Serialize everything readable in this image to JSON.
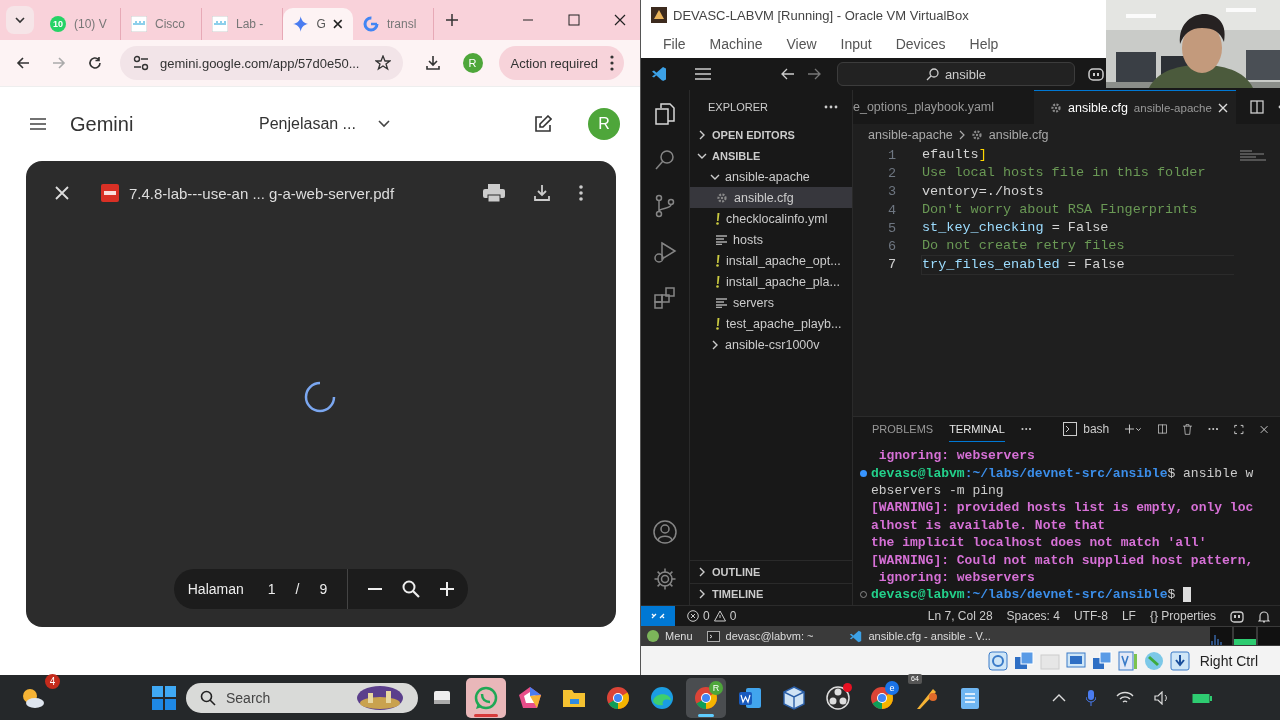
{
  "browser": {
    "tabs": [
      {
        "label": "(10) V",
        "kind": "whatsapp",
        "badge": "10",
        "selected": false
      },
      {
        "label": "Cisco",
        "kind": "cisco",
        "selected": false
      },
      {
        "label": "Lab -",
        "kind": "cisco",
        "selected": false
      },
      {
        "label": "G",
        "kind": "gemini",
        "selected": true
      },
      {
        "label": "transl",
        "kind": "google",
        "selected": false
      }
    ],
    "address": "gemini.google.com/app/57d0e50...",
    "profile_initial": "R",
    "action_button": "Action required"
  },
  "gemini": {
    "title": "Gemini",
    "conversation": "Penjelasan ...",
    "avatar_initial": "R",
    "pdf_viewer": {
      "file_name": "7.4.8-lab---use-an ... g-a-web-server.pdf",
      "loading": true,
      "page_label": "Halaman",
      "page": "1",
      "separator": "/",
      "page_count": "9"
    }
  },
  "vm_window": {
    "title": "DEVASC-LABVM [Running] - Oracle VM VirtualBox",
    "menu": [
      "File",
      "Machine",
      "View",
      "Input",
      "Devices",
      "Help"
    ],
    "host_key": "Right Ctrl"
  },
  "vscode": {
    "search": "ansible",
    "activity_bar": [
      {
        "kind": "explorer",
        "selected": true
      },
      {
        "kind": "search",
        "selected": false
      },
      {
        "kind": "source-control",
        "selected": false
      },
      {
        "kind": "run",
        "selected": false
      },
      {
        "kind": "extensions",
        "selected": false
      }
    ],
    "explorer": {
      "title": "EXPLORER",
      "sections": [
        {
          "label": "OPEN EDITORS",
          "expanded": false,
          "selected": false
        },
        {
          "label": "ANSIBLE",
          "expanded": true,
          "selected": false,
          "children": [
            {
              "label": "ansible-apache",
              "kind": "folder",
              "expanded": true,
              "selected": false,
              "children": [
                {
                  "label": "ansible.cfg",
                  "kind": "gear",
                  "selected": true
                },
                {
                  "label": "checklocalinfo.yml",
                  "kind": "yaml",
                  "selected": false
                },
                {
                  "label": "hosts",
                  "kind": "lines",
                  "selected": false
                },
                {
                  "label": "install_apache_opt...",
                  "kind": "yaml",
                  "selected": false
                },
                {
                  "label": "install_apache_pla...",
                  "kind": "yaml",
                  "selected": false
                },
                {
                  "label": "servers",
                  "kind": "lines",
                  "selected": false
                },
                {
                  "label": "test_apache_playb...",
                  "kind": "yaml",
                  "selected": false
                }
              ]
            },
            {
              "label": "ansible-csr1000v",
              "kind": "folder",
              "expanded": false,
              "selected": false
            }
          ]
        }
      ],
      "bottom_sections": [
        {
          "label": "OUTLINE",
          "expanded": false
        },
        {
          "label": "TIMELINE",
          "expanded": false
        }
      ]
    },
    "editor_tabs": [
      {
        "label": "e_options_playbook.yaml",
        "selected": false
      },
      {
        "label": "ansible.cfg",
        "description": "ansible-apache",
        "selected": true
      }
    ],
    "breadcrumb": [
      "ansible-apache",
      "ansible.cfg"
    ],
    "code_lines": [
      {
        "number": "1",
        "current": false,
        "tokens": [
          {
            "text": "efaults",
            "kind": "plain"
          },
          {
            "text": "]",
            "kind": "bracket"
          }
        ]
      },
      {
        "number": "2",
        "current": false,
        "tokens": [
          {
            "text": "Use local hosts file in this folder",
            "kind": "comment"
          }
        ]
      },
      {
        "number": "3",
        "current": false,
        "tokens": [
          {
            "text": "ventory=./hosts",
            "kind": "plain"
          }
        ]
      },
      {
        "number": "4",
        "current": false,
        "tokens": [
          {
            "text": "Don't worry about RSA Fingerprints",
            "kind": "comment"
          }
        ]
      },
      {
        "number": "5",
        "current": false,
        "tokens": [
          {
            "text": "st_key_checking",
            "kind": "key"
          },
          {
            "text": " = False",
            "kind": "plain"
          }
        ]
      },
      {
        "number": "6",
        "current": false,
        "tokens": [
          {
            "text": "Do not create retry files",
            "kind": "comment"
          }
        ]
      },
      {
        "number": "7",
        "current": true,
        "tokens": [
          {
            "text": "try_files_enabled",
            "kind": "key"
          },
          {
            "text": " = False",
            "kind": "plain"
          }
        ]
      }
    ],
    "panel": {
      "tabs": [
        {
          "label": "PROBLEMS",
          "selected": false
        },
        {
          "label": "TERMINAL",
          "selected": true
        }
      ],
      "shell": "bash",
      "terminal_lines": [
        {
          "tokens": [
            {
              "text": " ignoring: webservers",
              "kind": "warning"
            }
          ]
        },
        {
          "kind": "prompt",
          "completed": true,
          "tokens": [
            {
              "text": "devasc@labvm",
              "kind": "user"
            },
            {
              "text": ":~/labs/devnet-src/ansible",
              "kind": "path"
            },
            {
              "text": "$ ansible w",
              "kind": "plain"
            }
          ]
        },
        {
          "tokens": [
            {
              "text": "ebservers -m ping",
              "kind": "plain"
            }
          ]
        },
        {
          "tokens": [
            {
              "text": "[WARNING]: provided hosts list is empty, only loc",
              "kind": "warning"
            }
          ]
        },
        {
          "tokens": [
            {
              "text": "alhost is available. Note that",
              "kind": "warning"
            }
          ]
        },
        {
          "tokens": [
            {
              "text": "the implicit localhost does not match 'all'",
              "kind": "warning"
            }
          ]
        },
        {
          "tokens": [
            {
              "text": "[WARNING]: Could not match supplied host pattern,",
              "kind": "warning"
            }
          ]
        },
        {
          "tokens": [
            {
              "text": " ignoring: webservers",
              "kind": "warning"
            }
          ]
        },
        {
          "kind": "prompt",
          "completed": false,
          "cursor": true,
          "tokens": [
            {
              "text": "devasc@labvm",
              "kind": "user"
            },
            {
              "text": ":~/labs/devnet-src/ansible",
              "kind": "path"
            },
            {
              "text": "$",
              "kind": "plain"
            }
          ]
        }
      ]
    },
    "status_bar": {
      "errors": "0",
      "warnings": "0",
      "items": [
        "Ln 7, Col 28",
        "Spaces: 4",
        "UTF-8",
        "LF",
        "{} Properties"
      ]
    }
  },
  "guest_taskbar": {
    "menu": "Menu",
    "windows": [
      {
        "label": "devasc@labvm: ~",
        "kind": "terminal"
      },
      {
        "label": "ansible.cfg - ansible - V...",
        "kind": "vscode"
      }
    ]
  },
  "taskbar": {
    "weather_badge": "4",
    "search": {
      "placeholder": "Search"
    },
    "apps": [
      {
        "kind": "task-view",
        "active": false
      },
      {
        "kind": "whatsapp",
        "active": true
      },
      {
        "kind": "pentagon",
        "active": false
      },
      {
        "kind": "folder",
        "active": false
      },
      {
        "kind": "chrome",
        "active": false
      },
      {
        "kind": "edge",
        "active": false
      },
      {
        "kind": "chrome",
        "active": true,
        "badge": "R"
      },
      {
        "kind": "word",
        "active": false
      },
      {
        "kind": "cube",
        "active": false
      },
      {
        "kind": "record",
        "active": false,
        "alert": true
      },
      {
        "kind": "chrome",
        "active": false,
        "badge": "e"
      },
      {
        "kind": "app",
        "active": false,
        "badge": "64"
      },
      {
        "kind": "notepad",
        "active": false
      }
    ]
  }
}
